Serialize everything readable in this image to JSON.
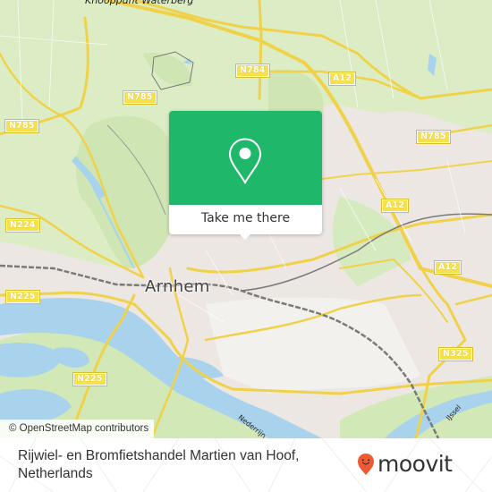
{
  "map": {
    "place_labels": {
      "city": "Arnhem",
      "junction": "Knooppunt Waterberg",
      "river_nederrijn": "Nederrijn",
      "river_ijssel": "IJssel"
    },
    "road_labels": [
      {
        "id": "n785-a",
        "text": "N785"
      },
      {
        "id": "n785-b",
        "text": "N785"
      },
      {
        "id": "n785-c",
        "text": "N785"
      },
      {
        "id": "n784",
        "text": "N784"
      },
      {
        "id": "a12-a",
        "text": "A12"
      },
      {
        "id": "a12-b",
        "text": "A12"
      },
      {
        "id": "a12-c",
        "text": "A12"
      },
      {
        "id": "n224",
        "text": "N224"
      },
      {
        "id": "n225-a",
        "text": "N225"
      },
      {
        "id": "n225-b",
        "text": "N225"
      },
      {
        "id": "n325",
        "text": "N325"
      }
    ],
    "attribution": "© OpenStreetMap contributors",
    "colors": {
      "urban": "#ede7e3",
      "park": "#d8ecc0",
      "forest": "#c8e3a8",
      "water": "#a9d3ec",
      "road": "#f7e14a",
      "rail": "#777777"
    }
  },
  "popup": {
    "icon": "map-pin-icon",
    "cta_label": "Take me there",
    "accent_color": "#1fb86b"
  },
  "footer": {
    "place_name": "Rijwiel- en Bromfietshandel Martien van Hoof, Netherlands",
    "brand": "moovit",
    "brand_icon": "moovit-smiley-pin-icon",
    "brand_color": "#f05a32"
  }
}
